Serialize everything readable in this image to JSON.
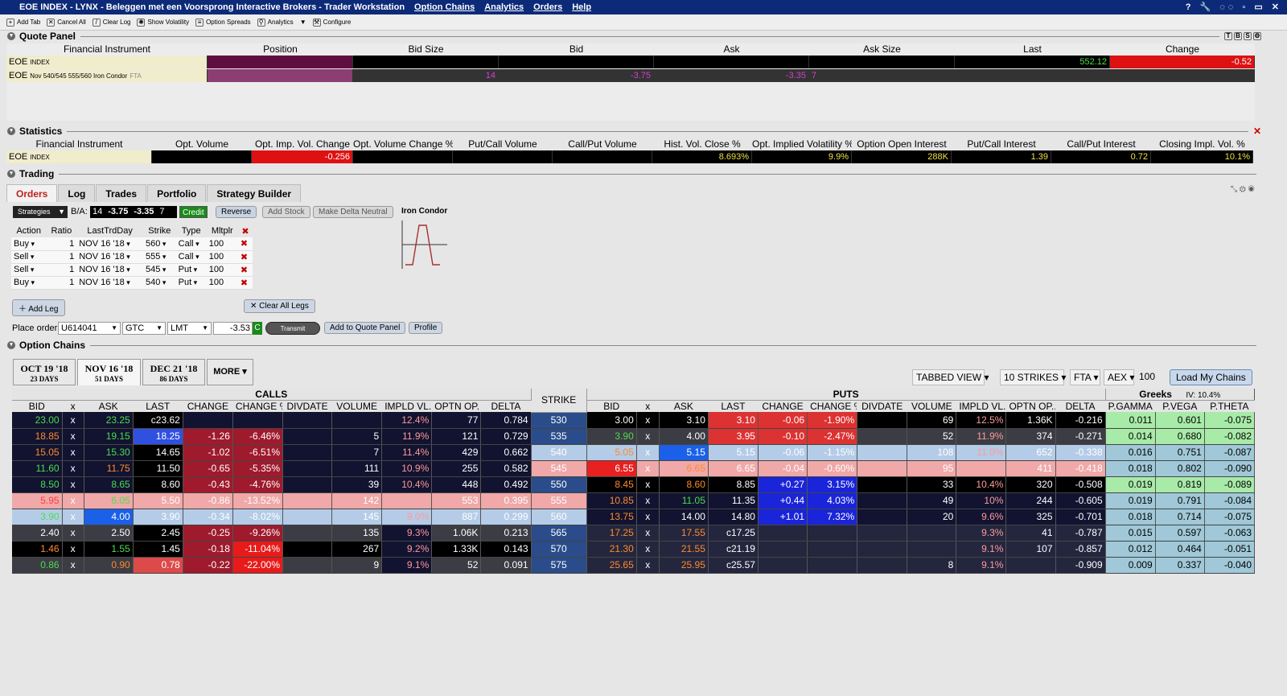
{
  "titlebar": {
    "instrument": "EOE INDEX",
    "title": "LYNX - Beleggen met een Voorsprong Interactive Brokers - Trader Workstation",
    "menus": [
      "Option Chains",
      "Analytics",
      "Orders",
      "Help"
    ],
    "controls": "? 🔧 ◌◌ ▫ ▭ ✕"
  },
  "toolbar": {
    "items": [
      "Add Tab",
      "Cancel All",
      "Clear Log",
      "Show Volatility",
      "Option Spreads",
      "Analytics",
      "▼",
      "Configure"
    ]
  },
  "quote_panel": {
    "title": "Quote Panel",
    "headers": [
      "Financial Instrument",
      "Position",
      "Bid Size",
      "Bid",
      "Ask",
      "Ask Size",
      "Last",
      "Change"
    ],
    "rows": [
      {
        "instrument": "EOE",
        "instrument_sub": "INDEX",
        "position": "",
        "bid_size": "",
        "bid": "",
        "ask": "",
        "ask_size": "",
        "last": "552.12",
        "change": "-0.52"
      },
      {
        "instrument": "EOE",
        "instrument_sub": "Nov 540/545 555/560 Iron Condor",
        "instrument_tag": "FTA",
        "position": "",
        "bid_size": "14",
        "bid": "-3.75",
        "ask": "-3.35",
        "ask_size": "7",
        "last": "",
        "change": ""
      }
    ],
    "header_icons": [
      "T",
      "B",
      "S",
      "⚙"
    ]
  },
  "statistics": {
    "title": "Statistics",
    "headers": [
      "Financial Instrument",
      "Opt. Volume",
      "Opt. Imp. Vol. Change",
      "Opt. Volume Change %",
      "Put/Call Volume",
      "Call/Put Volume",
      "Hist. Vol. Close %",
      "Opt. Implied Volatility %",
      "Option Open Interest",
      "Put/Call Interest",
      "Call/Put Interest",
      "Closing Impl. Vol. %"
    ],
    "row": {
      "instrument": "EOE",
      "instrument_sub": "INDEX",
      "values": [
        "",
        "-0.256",
        "",
        "",
        "",
        "8.693%",
        "9.9%",
        "288K",
        "1.39",
        "0.72",
        "10.1%"
      ]
    }
  },
  "trading": {
    "title": "Trading",
    "tabs": [
      "Orders",
      "Log",
      "Trades",
      "Portfolio",
      "Strategy Builder"
    ],
    "active_tab": "Orders",
    "strategies_label": "Strategies",
    "ba_label": "B/A:",
    "ba_bid_size": "14",
    "ba_bid": "-3.75",
    "ba_ask": "-3.35",
    "ba_ask_size": "7",
    "credit_label": "Credit",
    "buttons": {
      "reverse": "Reverse",
      "add_stock": "Add Stock",
      "make_delta_neutral": "Make Delta Neutral",
      "add_leg": "Add Leg",
      "clear_all_legs": "Clear All Legs",
      "transmit": "Transmit",
      "add_to_quote_panel": "Add to Quote Panel",
      "profile": "Profile"
    },
    "strategy_name": "Iron Condor",
    "leg_headers": [
      "Action",
      "Ratio",
      "LastTrdDay",
      "Strike",
      "Type",
      "Mltplr"
    ],
    "legs": [
      {
        "action": "Buy",
        "ratio": "1",
        "day": "NOV 16 '18",
        "strike": "560",
        "type": "Call",
        "mult": "100"
      },
      {
        "action": "Sell",
        "ratio": "1",
        "day": "NOV 16 '18",
        "strike": "555",
        "type": "Call",
        "mult": "100"
      },
      {
        "action": "Sell",
        "ratio": "1",
        "day": "NOV 16 '18",
        "strike": "545",
        "type": "Put",
        "mult": "100"
      },
      {
        "action": "Buy",
        "ratio": "1",
        "day": "NOV 16 '18",
        "strike": "540",
        "type": "Put",
        "mult": "100"
      }
    ],
    "place_order_label": "Place order:",
    "account": "U614041",
    "tif": "GTC",
    "order_type": "LMT",
    "limit_price": "-3.53",
    "c_badge": "C"
  },
  "option_chains": {
    "title": "Option Chains",
    "expiries": [
      {
        "date": "OCT 19 '18",
        "days": "23 DAYS"
      },
      {
        "date": "NOV 16 '18",
        "days": "51 DAYS"
      },
      {
        "date": "DEC 21 '18",
        "days": "86 DAYS"
      }
    ],
    "more_label": "MORE",
    "active_expiry": 1,
    "view": "TABBED VIEW",
    "strikes_count": "10 STRIKES",
    "exchange": "FTA",
    "index": "AEX",
    "multiplier": "100",
    "load_button": "Load My Chains",
    "calls_label": "CALLS",
    "puts_label": "PUTS",
    "strike_label": "STRIKE",
    "greeks_label": "Greeks",
    "iv_label": "IV: 10.4%",
    "call_headers": [
      "BID",
      "x",
      "ASK",
      "LAST",
      "CHANGE",
      "CHANGE %",
      "DIVDATE",
      "VOLUME",
      "IMPLD VL...",
      "OPTN OP...",
      "DELTA"
    ],
    "put_headers": [
      "BID",
      "x",
      "ASK",
      "LAST",
      "CHANGE",
      "CHANGE %",
      "DIVDATE",
      "VOLUME",
      "IMPLD VL...",
      "OPTN OP...",
      "DELTA"
    ],
    "greek_headers": [
      "P.GAMMA",
      "P.VEGA",
      "P.THETA"
    ],
    "rows": [
      {
        "strike": "530",
        "call": [
          "23.00",
          "x",
          "23.25",
          "c23.62",
          "",
          "",
          "",
          "",
          "12.4%",
          "77",
          "0.784"
        ],
        "put": [
          "3.00",
          "x",
          "3.10",
          "3.10",
          "-0.06",
          "-1.90%",
          "",
          "69",
          "12.5%",
          "1.36K",
          "-0.216"
        ],
        "greeks": [
          "0.011",
          "0.601",
          "-0.075"
        ]
      },
      {
        "strike": "535",
        "call": [
          "18.85",
          "x",
          "19.15",
          "18.25",
          "-1.26",
          "-6.46%",
          "",
          "5",
          "11.9%",
          "121",
          "0.729"
        ],
        "put": [
          "3.90",
          "x",
          "4.00",
          "3.95",
          "-0.10",
          "-2.47%",
          "",
          "52",
          "11.9%",
          "374",
          "-0.271"
        ],
        "greeks": [
          "0.014",
          "0.680",
          "-0.082"
        ]
      },
      {
        "strike": "540",
        "call": [
          "15.05",
          "x",
          "15.30",
          "14.65",
          "-1.02",
          "-6.51%",
          "",
          "7",
          "11.4%",
          "429",
          "0.662"
        ],
        "put": [
          "5.05",
          "x",
          "5.15",
          "5.15",
          "-0.06",
          "-1.15%",
          "",
          "108",
          "11.0%",
          "652",
          "-0.338"
        ],
        "greeks": [
          "0.016",
          "0.751",
          "-0.087"
        ]
      },
      {
        "strike": "545",
        "call": [
          "11.60",
          "x",
          "11.75",
          "11.50",
          "-0.65",
          "-5.35%",
          "",
          "111",
          "10.9%",
          "255",
          "0.582"
        ],
        "put": [
          "6.55",
          "x",
          "6.65",
          "6.65",
          "-0.04",
          "-0.60%",
          "",
          "95",
          "",
          "411",
          "-0.418"
        ],
        "greeks": [
          "0.018",
          "0.802",
          "-0.090"
        ]
      },
      {
        "strike": "550",
        "call": [
          "8.50",
          "x",
          "8.65",
          "8.60",
          "-0.43",
          "-4.76%",
          "",
          "39",
          "10.4%",
          "448",
          "0.492"
        ],
        "put": [
          "8.45",
          "x",
          "8.60",
          "8.85",
          "+0.27",
          "3.15%",
          "",
          "33",
          "10.4%",
          "320",
          "-0.508"
        ],
        "greeks": [
          "0.019",
          "0.819",
          "-0.089"
        ]
      },
      {
        "strike": "555",
        "call": [
          "5.95",
          "x",
          "6.05",
          "5.50",
          "-0.86",
          "-13.52%",
          "",
          "142",
          "",
          "553",
          "0.395"
        ],
        "put": [
          "10.85",
          "x",
          "11.05",
          "11.35",
          "+0.44",
          "4.03%",
          "",
          "49",
          "10%",
          "244",
          "-0.605"
        ],
        "greeks": [
          "0.019",
          "0.791",
          "-0.084"
        ]
      },
      {
        "strike": "560",
        "call": [
          "3.90",
          "x",
          "4.00",
          "3.90",
          "-0.34",
          "-8.02%",
          "",
          "145",
          "9.0%",
          "887",
          "0.299"
        ],
        "put": [
          "13.75",
          "x",
          "14.00",
          "14.80",
          "+1.01",
          "7.32%",
          "",
          "20",
          "9.6%",
          "325",
          "-0.701"
        ],
        "greeks": [
          "0.018",
          "0.714",
          "-0.075"
        ]
      },
      {
        "strike": "565",
        "call": [
          "2.40",
          "x",
          "2.50",
          "2.45",
          "-0.25",
          "-9.26%",
          "",
          "135",
          "9.3%",
          "1.06K",
          "0.213"
        ],
        "put": [
          "17.25",
          "x",
          "17.55",
          "c17.25",
          "",
          "",
          "",
          "",
          "9.3%",
          "41",
          "-0.787"
        ],
        "greeks": [
          "0.015",
          "0.597",
          "-0.063"
        ]
      },
      {
        "strike": "570",
        "call": [
          "1.46",
          "x",
          "1.55",
          "1.45",
          "-0.18",
          "-11.04%",
          "",
          "267",
          "9.2%",
          "1.33K",
          "0.143"
        ],
        "put": [
          "21.30",
          "x",
          "21.55",
          "c21.19",
          "",
          "",
          "",
          "",
          "9.1%",
          "107",
          "-0.857"
        ],
        "greeks": [
          "0.012",
          "0.464",
          "-0.051"
        ]
      },
      {
        "strike": "575",
        "call": [
          "0.86",
          "x",
          "0.90",
          "0.78",
          "-0.22",
          "-22.00%",
          "",
          "9",
          "9.1%",
          "52",
          "0.091"
        ],
        "put": [
          "25.65",
          "x",
          "25.95",
          "c25.57",
          "",
          "",
          "",
          "8",
          "9.1%",
          "",
          "-0.909"
        ],
        "greeks": [
          "0.009",
          "0.337",
          "-0.040"
        ]
      }
    ]
  }
}
